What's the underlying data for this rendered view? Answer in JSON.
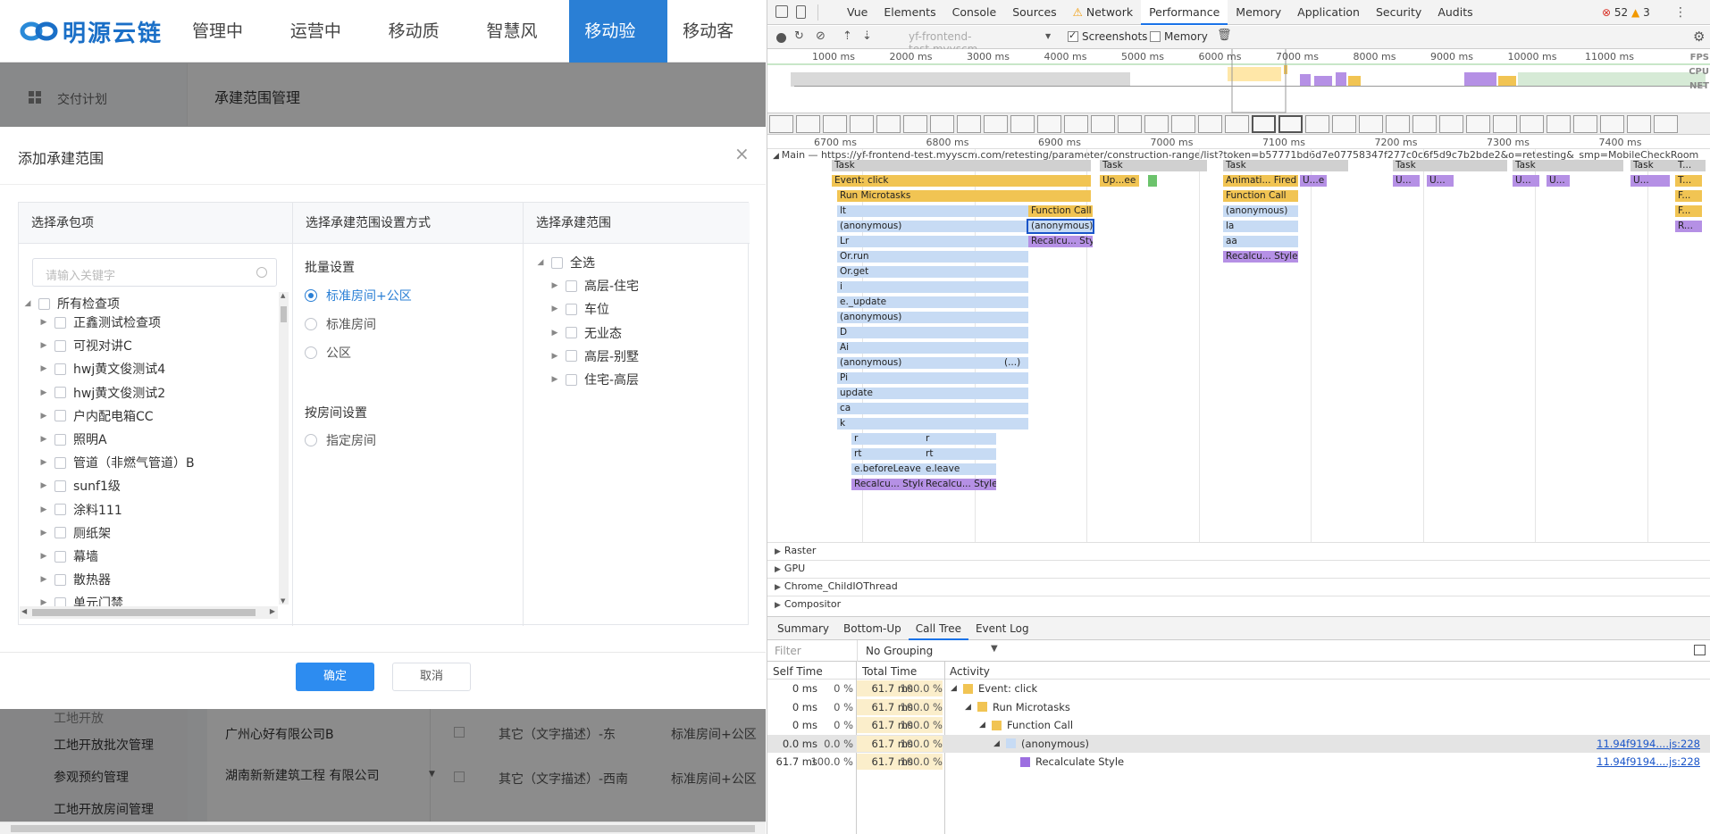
{
  "app": {
    "logo_text": "明源云链",
    "nav": [
      "管理中心",
      "运营中心",
      "移动质检",
      "智慧风控",
      "移动验房",
      "移动客服"
    ],
    "nav_active": 4,
    "side_top": "交付计划",
    "page_title": "承建范围管理",
    "side_bottom": [
      "工地开放",
      "工地开放批次管理",
      "参观预约管理",
      "工地开放房间管理"
    ],
    "bg_rows": [
      {
        "company": "广州心好有限公司B",
        "desc": "其它（文字描述）-东",
        "type": "标准房间+公区"
      },
      {
        "company": "湖南新新建筑工程 有限公司",
        "desc": "其它（文字描述）-西南",
        "type": "标准房间+公区"
      }
    ]
  },
  "modal": {
    "title": "添加承建范围",
    "col1_title": "选择承包项",
    "col2_title": "选择承建范围设置方式",
    "col3_title": "选择承建范围",
    "search_placeholder": "请输入关键字",
    "tree_root": "所有检查项",
    "tree_items": [
      "正鑫测试检查项",
      "可视对讲C",
      "hwj黄文俊测试4",
      "hwj黄文俊测试2",
      "户内配电箱CC",
      "照明A",
      "管道（非燃气管道）B",
      "sunf1级",
      "涂料111",
      "厕纸架",
      "幕墙",
      "散热器",
      "单元门禁"
    ],
    "batch_label": "批量设置",
    "radio_options": [
      "标准房间+公区",
      "标准房间",
      "公区"
    ],
    "radio_selected": 0,
    "room_label": "按房间设置",
    "room_option": "指定房间",
    "range_all": "全选",
    "range_items": [
      "高层-住宅",
      "车位",
      "无业态",
      "高层-别墅",
      "住宅-高层"
    ],
    "ok": "确定",
    "cancel": "取消"
  },
  "devtools": {
    "tabs": [
      "Vue",
      "Elements",
      "Console",
      "Sources",
      "Network",
      "Performance",
      "Memory",
      "Application",
      "Security",
      "Audits"
    ],
    "active_tab": "Performance",
    "network_warning": "⚠",
    "errors": "52",
    "warnings": "3",
    "url_select": "yf-frontend-test.myyscm....",
    "screenshots_label": "Screenshots",
    "memory_label": "Memory",
    "overview_ticks": [
      "1000 ms",
      "2000 ms",
      "3000 ms",
      "4000 ms",
      "5000 ms",
      "6000 ms",
      "7000 ms",
      "8000 ms",
      "9000 ms",
      "10000 ms",
      "11000 ms"
    ],
    "lane_labels": [
      "FPS",
      "CPU",
      "NET"
    ],
    "detail_ticks": [
      "6700 ms",
      "6800 ms",
      "6900 ms",
      "7000 ms",
      "7100 ms",
      "7200 ms",
      "7300 ms",
      "7400 ms"
    ],
    "main_label": "Main — https://yf-frontend-test.myyscm.com/retesting/parameter/construction-range/list?token=b57771bd6d7e07758347f277c0c6f5d9c7b2bde2&o=retesting&_smp=MobileCheckRoom",
    "flame": {
      "task": "Task",
      "event_click": "Event: click",
      "run_microtasks": "Run Microtasks",
      "function_call": "Function Call",
      "anonymous": "(anonymous)",
      "recalc": "Recalcu... Style",
      "stack": [
        "lt",
        "(anonymous)",
        "Lr",
        "Or.run",
        "Or.get",
        "i",
        "e._update",
        "(anonymous)",
        "D",
        "Ai",
        "(anonymous)",
        "Pi",
        "update",
        "ca",
        "k"
      ],
      "split": [
        [
          "r",
          "r"
        ],
        [
          "rt",
          "rt"
        ],
        [
          "e.beforeLeave",
          "e.leave"
        ]
      ],
      "ellipsis": "(...)",
      "update_short": "Up...ee",
      "anim": "Animati... Fired",
      "ue": "U...e",
      "la": "la",
      "aa": "aa",
      "u": "U...",
      "t": "T...",
      "f": "F...",
      "r": "R..."
    },
    "tracks": [
      "Raster",
      "GPU",
      "Chrome_ChildIOThread",
      "Compositor"
    ],
    "bottom_tabs": [
      "Summary",
      "Bottom-Up",
      "Call Tree",
      "Event Log"
    ],
    "bottom_active": "Call Tree",
    "filter_placeholder": "Filter",
    "grouping": "No Grouping",
    "headers": [
      "Self Time",
      "Total Time",
      "Activity"
    ],
    "rows": [
      {
        "self": "0 ms",
        "self_pct": "0 %",
        "total": "61.7 ms",
        "total_pct": "100.0 %",
        "name": "Event: click",
        "color": "#f1c453",
        "indent": 0,
        "twisty": "◢",
        "link": ""
      },
      {
        "self": "0 ms",
        "self_pct": "0 %",
        "total": "61.7 ms",
        "total_pct": "100.0 %",
        "name": "Run Microtasks",
        "color": "#f1c453",
        "indent": 1,
        "twisty": "◢",
        "link": ""
      },
      {
        "self": "0 ms",
        "self_pct": "0 %",
        "total": "61.7 ms",
        "total_pct": "100.0 %",
        "name": "Function Call",
        "color": "#f1c453",
        "indent": 2,
        "twisty": "◢",
        "link": ""
      },
      {
        "self": "0.0 ms",
        "self_pct": "0.0 %",
        "total": "61.7 ms",
        "total_pct": "100.0 %",
        "name": "(anonymous)",
        "color": "#c7dbf4",
        "indent": 3,
        "twisty": "◢",
        "link": "11.94f9194....js:228"
      },
      {
        "self": "61.7 ms",
        "self_pct": "100.0 %",
        "total": "61.7 ms",
        "total_pct": "100.0 %",
        "name": "Recalculate Style",
        "color": "#9c6ee0",
        "indent": 4,
        "twisty": "",
        "link": "11.94f9194....js:228"
      }
    ]
  }
}
